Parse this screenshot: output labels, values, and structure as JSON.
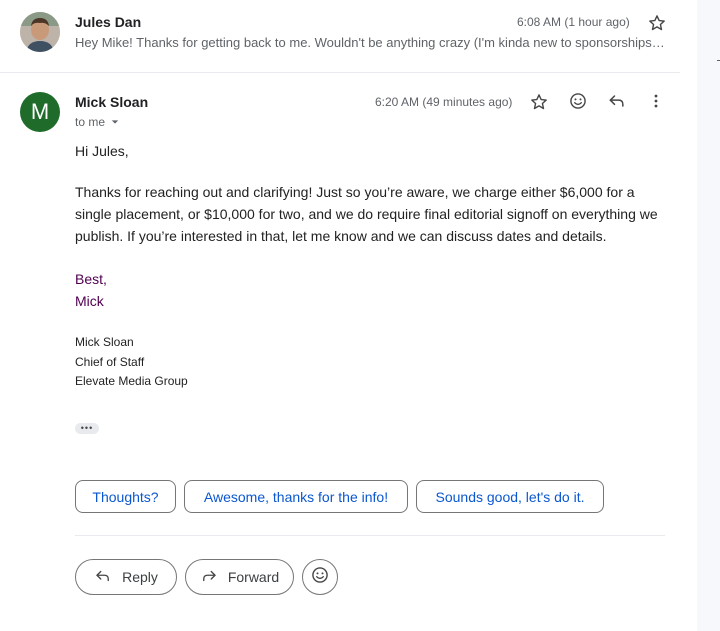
{
  "collapsed_message": {
    "sender": "Jules Dan",
    "time": "6:08 AM (1 hour ago)",
    "snippet": "Hey Mike! Thanks for getting back to me. Wouldn't be anything crazy (I'm kinda new to sponsorships). ..."
  },
  "expanded_message": {
    "avatar_letter": "M",
    "sender": "Mick Sloan",
    "time": "6:20 AM (49 minutes ago)",
    "recipient": "to me",
    "greeting": "Hi Jules,",
    "paragraph": "Thanks for reaching out and clarifying! Just so you’re aware, we charge either $6,000 for a single placement, or $10,000 for two, and we do require final editorial signoff on everything we publish. If you’re interested in that, let me know and we can discuss dates and details.",
    "signoff_line1": "Best,",
    "signoff_line2": "Mick",
    "signature": {
      "name": "Mick Sloan",
      "title": "Chief of Staff",
      "company": "Elevate Media Group"
    },
    "trimmed_content": "•••"
  },
  "smart_replies": [
    "Thoughts?",
    "Awesome, thanks for the info!",
    "Sounds good, let's do it."
  ],
  "actions": {
    "reply": "Reply",
    "forward": "Forward"
  },
  "colors": {
    "avatar_bg": "#1e6b2a",
    "signoff": "#500050",
    "smart_reply_text": "#0b57d0"
  }
}
